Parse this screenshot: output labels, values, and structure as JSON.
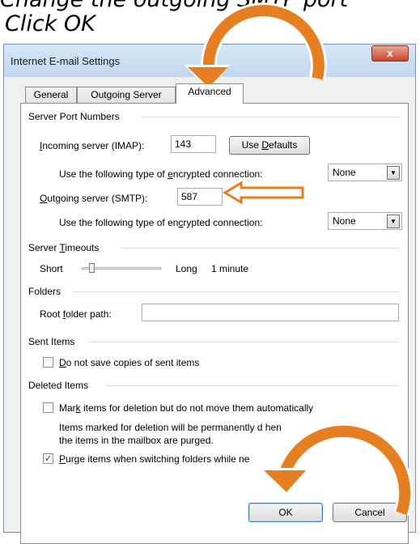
{
  "caption_top": "Change the outgoing SMTP port",
  "caption": "Click OK",
  "window": {
    "title": "Internet E-mail Settings",
    "close_symbol": "x"
  },
  "tabs": [
    {
      "label": "General",
      "active": false
    },
    {
      "label": "Outgoing Server",
      "active": false
    },
    {
      "label": "Advanced",
      "active": true
    }
  ],
  "server_ports": {
    "group_label": "Server Port Numbers",
    "incoming_label": "Incoming server (IMAP):",
    "incoming_value": "143",
    "use_defaults_label": "Use Defaults",
    "encryption_label_1": "Use the following type of encrypted connection:",
    "encryption_value_1": "None",
    "outgoing_label": "Outgoing server (SMTP):",
    "outgoing_value": "587",
    "encryption_label_2": "Use the following type of encrypted connection:",
    "encryption_value_2": "None"
  },
  "server_timeouts": {
    "group_label": "Server Timeouts",
    "short_label": "Short",
    "long_label": "Long",
    "timeout_value": "1 minute",
    "slider_position": 0.1
  },
  "folders": {
    "group_label": "Folders",
    "root_label": "Root folder path:",
    "root_value": ""
  },
  "sent_items": {
    "group_label": "Sent Items",
    "do_not_save_label": "Do not save copies of sent items",
    "do_not_save_checked": false
  },
  "deleted_items": {
    "group_label": "Deleted Items",
    "mark_label": "Mark items for deletion but do not move them automatically",
    "mark_checked": false,
    "info_line_1": "Items marked for deletion will be permanently d        hen",
    "info_line_2": "the items in the mailbox are purged.",
    "purge_label": "Purge items when switching folders while        ne",
    "purge_checked": true
  },
  "buttons": {
    "ok": "OK",
    "cancel": "Cancel"
  },
  "annotation_color": "#e67e22",
  "checkmark": "✓"
}
